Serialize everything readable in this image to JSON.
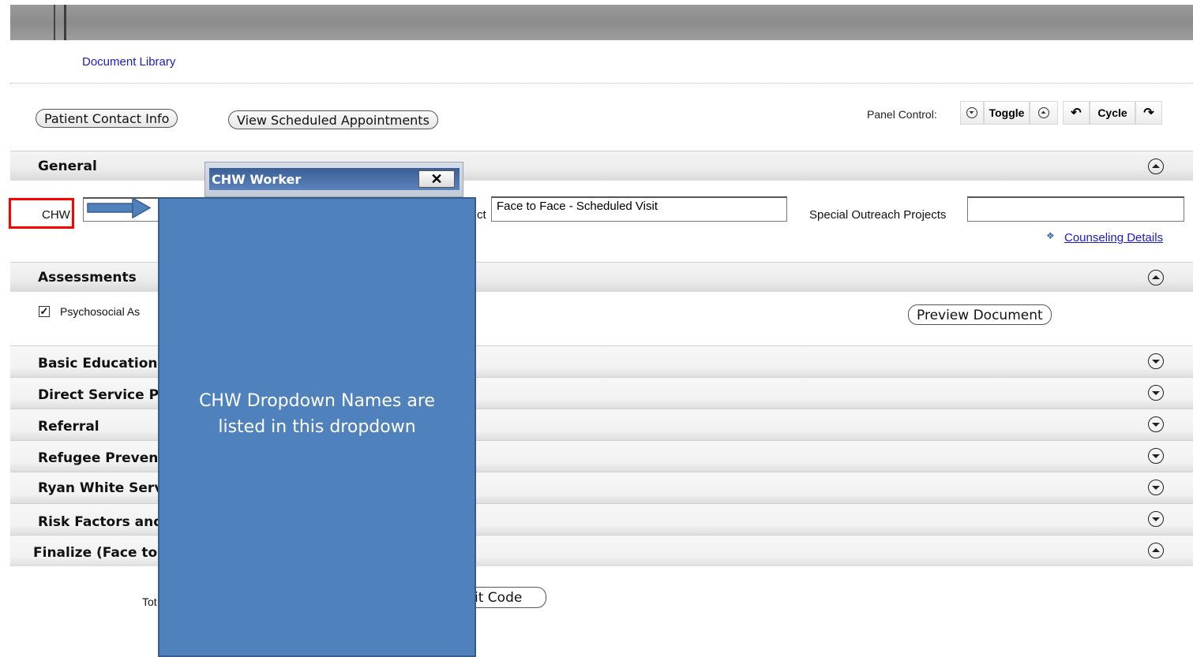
{
  "header": {
    "document_library_link": "Document Library"
  },
  "buttons": {
    "patient_contact_info": "Patient Contact Info",
    "view_scheduled_appointments": "View Scheduled Appointments",
    "preview_document": "Preview Document",
    "visit_code_partial": "it Code"
  },
  "panel_control": {
    "label": "Panel Control:",
    "toggle": "Toggle",
    "cycle": "Cycle"
  },
  "sections": {
    "general": "General",
    "assessments": "Assessments",
    "basic_education": "Basic Education",
    "direct_service": "Direct Service Pr",
    "referral": "Referral",
    "refugee": "Refugee Prevent",
    "ryan_white": "Ryan White Serv",
    "risk_factors": "Risk Factors and",
    "finalize": "Finalize (Face to"
  },
  "general": {
    "chw_label": "CHW",
    "contact_label_partial": "ct",
    "contact_value": "Face to Face - Scheduled Visit",
    "special_outreach_label": "Special Outreach Projects",
    "special_outreach_value": "",
    "counseling_link": "Counseling Details"
  },
  "assessments": {
    "psychosocial_label": "Psychosocial As",
    "psychosocial_checked": true
  },
  "finalize": {
    "total_label_partial": "Tot"
  },
  "dialog": {
    "title": "CHW Worker",
    "close": "✕"
  },
  "callout": {
    "text_line1": "CHW Dropdown Names are",
    "text_line2": "listed in this dropdown"
  },
  "colors": {
    "callout_fill": "#4f81bd",
    "highlight": "#ff0000",
    "link": "#1a1acc"
  }
}
